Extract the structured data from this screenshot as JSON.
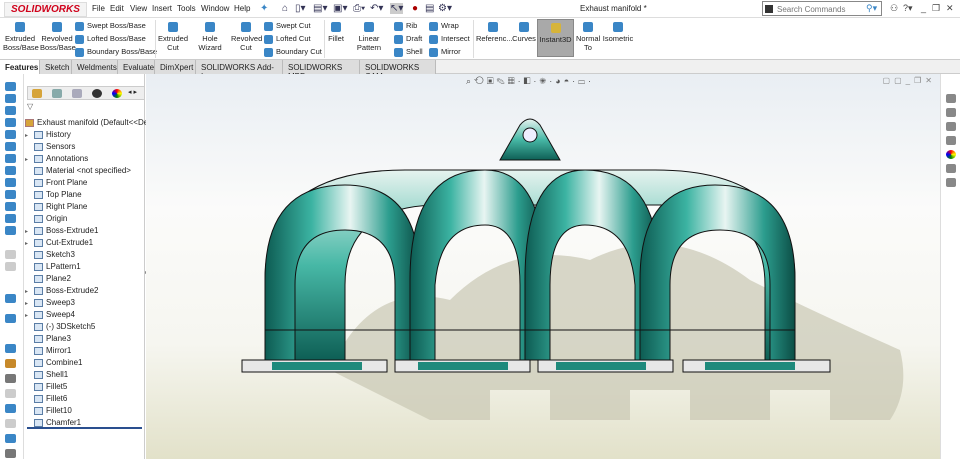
{
  "app": {
    "logo": "SOLIDWORKS",
    "title": "Exhaust manifold *",
    "search_placeholder": "Search Commands"
  },
  "menu": [
    "File",
    "Edit",
    "View",
    "Insert",
    "Tools",
    "Window",
    "Help"
  ],
  "ribbon": {
    "extruded_boss": "Extruded Boss/Base",
    "revolved_boss": "Revolved Boss/Base",
    "swept_boss": "Swept Boss/Base",
    "lofted_boss": "Lofted Boss/Base",
    "boundary_boss": "Boundary Boss/Base",
    "extruded_cut": "Extruded Cut",
    "hole_wizard": "Hole Wizard",
    "revolved_cut": "Revolved Cut",
    "swept_cut": "Swept Cut",
    "lofted_cut": "Lofted Cut",
    "boundary_cut": "Boundary Cut",
    "fillet": "Fillet",
    "linear_pattern": "Linear Pattern",
    "rib": "Rib",
    "draft": "Draft",
    "shell": "Shell",
    "wrap": "Wrap",
    "intersect": "Intersect",
    "mirror": "Mirror",
    "reference": "Referenc...",
    "curves": "Curves",
    "instant3d": "Instant3D",
    "normal_to": "Normal To",
    "isometric": "Isometric"
  },
  "tabs": [
    "Features",
    "Sketch",
    "Weldments",
    "Evaluate",
    "DimXpert",
    "SOLIDWORKS Add-Ins",
    "SOLIDWORKS MBD",
    "SOLIDWORKS CAM"
  ],
  "tree": {
    "root": "Exhaust manifold  (Default<<De",
    "items": [
      {
        "label": "History",
        "expand": true
      },
      {
        "label": "Sensors"
      },
      {
        "label": "Annotations",
        "expand": true
      },
      {
        "label": "Material <not specified>"
      },
      {
        "label": "Front Plane"
      },
      {
        "label": "Top Plane"
      },
      {
        "label": "Right Plane"
      },
      {
        "label": "Origin"
      },
      {
        "label": "Boss-Extrude1",
        "expand": true
      },
      {
        "label": "Cut-Extrude1",
        "expand": true
      },
      {
        "label": "Sketch3"
      },
      {
        "label": "LPattern1"
      },
      {
        "label": "Plane2"
      },
      {
        "label": "Boss-Extrude2",
        "expand": true
      },
      {
        "label": "Sweep3",
        "expand": true
      },
      {
        "label": "Sweep4",
        "expand": true
      },
      {
        "label": "(-) 3DSketch5"
      },
      {
        "label": "Plane3"
      },
      {
        "label": "Mirror1"
      },
      {
        "label": "Combine1"
      },
      {
        "label": "Shell1"
      },
      {
        "label": "Fillet5"
      },
      {
        "label": "Fillet6"
      },
      {
        "label": "Fillet10"
      },
      {
        "label": "Chamfer1"
      }
    ]
  },
  "colors": {
    "model": "#1f8a7c",
    "accent": "#d0021b"
  }
}
